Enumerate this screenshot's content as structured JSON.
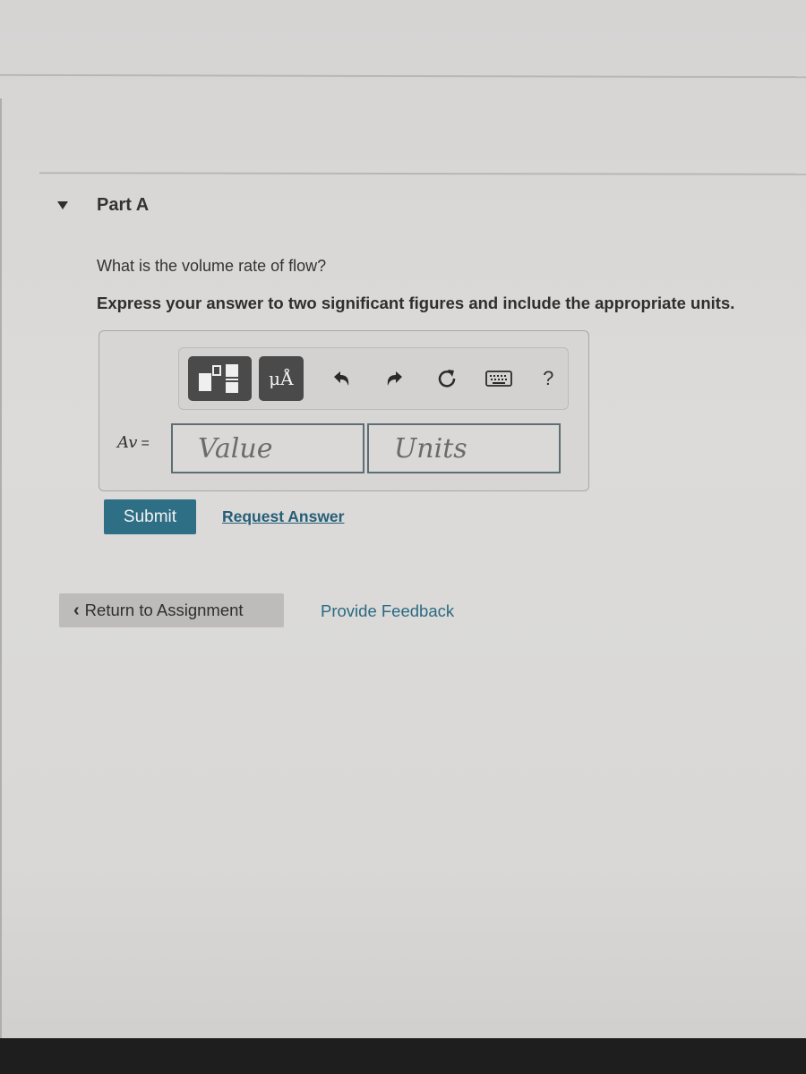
{
  "part": {
    "title": "Part A",
    "expanded": true
  },
  "question": {
    "prompt": "What is the volume rate of flow?",
    "instruction": "Express your answer to two significant figures and include the appropriate units."
  },
  "toolbar": {
    "templates_icon": "templates-icon",
    "units_label": "μÅ",
    "undo_icon": "undo-icon",
    "redo_icon": "redo-icon",
    "reset_icon": "reset-icon",
    "keyboard_icon": "keyboard-icon",
    "help_label": "?"
  },
  "answer": {
    "variable_label": "Av",
    "equals": "=",
    "value_placeholder": "Value",
    "value": "",
    "units_placeholder": "Units",
    "units": ""
  },
  "actions": {
    "submit_label": "Submit",
    "request_answer_label": "Request Answer",
    "return_label": "Return to Assignment",
    "feedback_label": "Provide Feedback"
  },
  "colors": {
    "primary_button": "#2e6f85",
    "link": "#245e77"
  }
}
